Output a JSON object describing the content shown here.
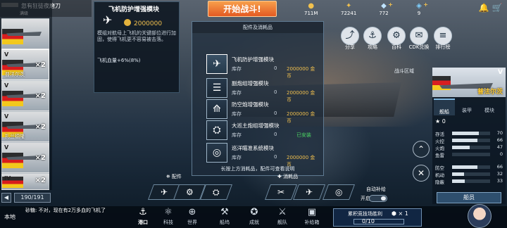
{
  "player": {
    "name": "忽有狂徒夜磨刀",
    "level": "满级"
  },
  "start_button": "开始战斗!",
  "resources": [
    {
      "icon": "coin-icon",
      "value": "711M"
    },
    {
      "icon": "honor-icon",
      "value": "72241"
    },
    {
      "icon": "diamond-icon",
      "value": "772"
    },
    {
      "icon": "gem-icon",
      "value": "9"
    }
  ],
  "tooltip": {
    "title": "飞机防护增强模块",
    "price": "2000000",
    "description": "模组对航母上飞机的关键部位进行加固，使得飞机更不容易被击落。",
    "effect": "飞机血量+6%(8%)"
  },
  "equipment": {
    "title": "配件及消耗品",
    "stock_label": "库存",
    "hint": "长按上方消耗品，配件可查看说明",
    "modules": [
      {
        "name": "飞机防护增强模块",
        "icon": "plane-shield-icon",
        "stock": "0",
        "price": "2000000 金币",
        "installed": ""
      },
      {
        "name": "副炮组增强模块",
        "icon": "secondary-gun-icon",
        "stock": "0",
        "price": "2000000 金币",
        "installed": ""
      },
      {
        "name": "防空炮增强模块",
        "icon": "aa-gun-icon",
        "stock": "0",
        "price": "2000000 金币",
        "installed": ""
      },
      {
        "name": "大巡主炮组增强模块",
        "icon": "main-gun-icon",
        "stock": "0",
        "price": "",
        "installed": "已安装"
      },
      {
        "name": "巡洋瞄准系统模块",
        "icon": "targeting-icon",
        "stock": "0",
        "price": "2000000 金币",
        "installed": ""
      }
    ],
    "accessories_label": "配件",
    "consumables_label": "消耗品",
    "auto_supply_label": "自动补给",
    "auto_supply_state": "开启"
  },
  "right_menu": [
    {
      "label": "分享",
      "icon": "share-icon"
    },
    {
      "label": "攻略",
      "icon": "guide-icon"
    },
    {
      "label": "百科",
      "icon": "wiki-icon"
    },
    {
      "label": "CDK兑换",
      "icon": "cdk-icon"
    },
    {
      "label": "排行榜",
      "icon": "ranking-icon"
    }
  ],
  "scene_label": "战斗区域",
  "fleet": {
    "ships": [
      {
        "tier": "V",
        "mult": "×2",
        "name": "普法尔茨"
      },
      {
        "tier": "V",
        "mult": "×2",
        "name": ""
      },
      {
        "tier": "V",
        "mult": "×2",
        "name": "扎兰德隆"
      },
      {
        "tier": "V",
        "mult": "×2",
        "name": ""
      },
      {
        "tier": "IV",
        "mult": "×2",
        "name": ""
      }
    ],
    "count": "190/191"
  },
  "ship_panel": {
    "name": "普法尔茨",
    "tier": "V",
    "tabs": [
      "舰船",
      "装甲",
      "模块"
    ],
    "stars": "0",
    "stats": [
      {
        "label": "存活",
        "value": "70",
        "level": 0.7
      },
      {
        "label": "火控",
        "value": "66",
        "level": 0.66
      },
      {
        "label": "火炮",
        "value": "47",
        "level": 0.47
      },
      {
        "label": "鱼雷",
        "value": "0",
        "level": 0
      },
      {
        "label": "防空",
        "value": "66",
        "level": 0.66
      },
      {
        "label": "机动",
        "value": "32",
        "level": 0.32
      },
      {
        "label": "隐蔽",
        "value": "33",
        "level": 0.33
      }
    ],
    "crew_button": "船员"
  },
  "bottom_nav": {
    "chat_label": "本地",
    "chat_message": "砂糖: 不对，现在有2万多血的飞机了",
    "items": [
      {
        "label": "港口",
        "icon": "port-icon"
      },
      {
        "label": "科技",
        "icon": "tech-icon"
      },
      {
        "label": "世界",
        "icon": "world-icon"
      },
      {
        "label": "船坞",
        "icon": "dock-icon"
      },
      {
        "label": "成就",
        "icon": "achievement-icon"
      },
      {
        "label": "舰队",
        "icon": "fleet-icon"
      },
      {
        "label": "补给箱",
        "icon": "supply-box-icon"
      }
    ],
    "arena_title": "累积竞技场胜利",
    "arena_progress": "0/10",
    "arena_reward": "× 1"
  }
}
